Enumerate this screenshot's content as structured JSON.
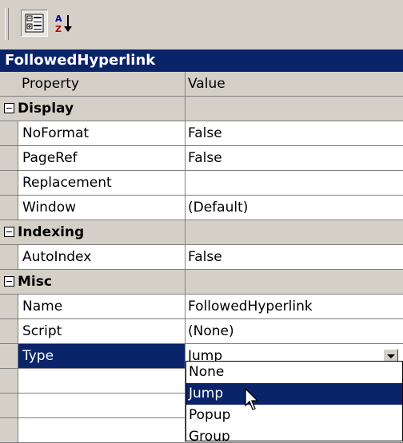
{
  "toolbar": {
    "categorized_icon": "categorized-icon",
    "alphabetical_icon": "sort-az-icon"
  },
  "object_name": "FollowedHyperlink",
  "grid": {
    "headers": {
      "property": "Property",
      "value": "Value"
    },
    "categories": [
      {
        "name": "Display",
        "rows": [
          {
            "property": "NoFormat",
            "value": "False"
          },
          {
            "property": "PageRef",
            "value": "False"
          },
          {
            "property": "Replacement",
            "value": ""
          },
          {
            "property": "Window",
            "value": "(Default)"
          }
        ]
      },
      {
        "name": "Indexing",
        "rows": [
          {
            "property": "AutoIndex",
            "value": "False"
          }
        ]
      },
      {
        "name": "Misc",
        "rows": [
          {
            "property": "Name",
            "value": "FollowedHyperlink"
          },
          {
            "property": "Script",
            "value": "(None)"
          },
          {
            "property": "Type",
            "value": "Jump"
          }
        ]
      }
    ]
  },
  "dropdown": {
    "options": [
      "None",
      "Jump",
      "Popup",
      "Group"
    ],
    "highlighted": "Jump"
  },
  "colors": {
    "selection": "#0a246a",
    "face": "#d4d0c8"
  }
}
